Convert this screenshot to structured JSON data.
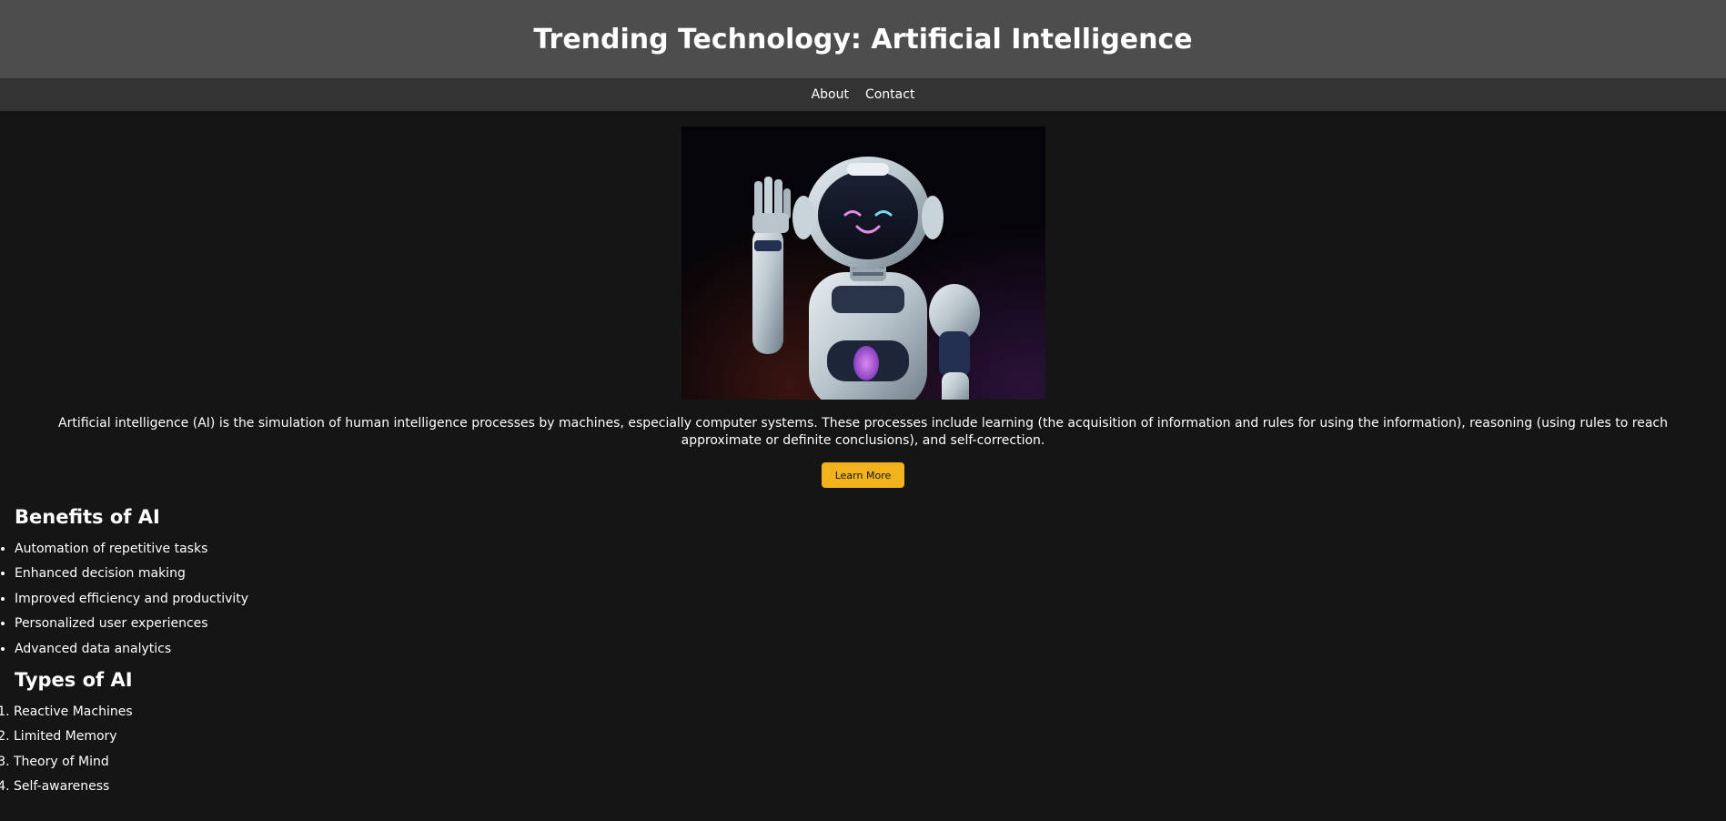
{
  "header": {
    "title": "Trending Technology: Artificial Intelligence"
  },
  "nav": {
    "items": [
      {
        "label": "About"
      },
      {
        "label": "Contact"
      }
    ]
  },
  "hero": {
    "image_subject": "friendly waving robot"
  },
  "intro": {
    "text": "Artificial intelligence (AI) is the simulation of human intelligence processes by machines, especially computer systems. These processes include learning (the acquisition of information and rules for using the information), reasoning (using rules to reach approximate or definite conclusions), and self-correction."
  },
  "cta": {
    "label": "Learn More"
  },
  "benefits": {
    "heading": "Benefits of AI",
    "items": [
      "Automation of repetitive tasks",
      "Enhanced decision making",
      "Improved efficiency and productivity",
      "Personalized user experiences",
      "Advanced data analytics"
    ]
  },
  "types": {
    "heading": "Types of AI",
    "items": [
      "Reactive Machines",
      "Limited Memory",
      "Theory of Mind",
      "Self-awareness"
    ]
  },
  "colors": {
    "header_bg": "#4d4d4d",
    "nav_bg": "#333333",
    "page_bg": "#151515",
    "button_bg": "#f2b21b"
  }
}
